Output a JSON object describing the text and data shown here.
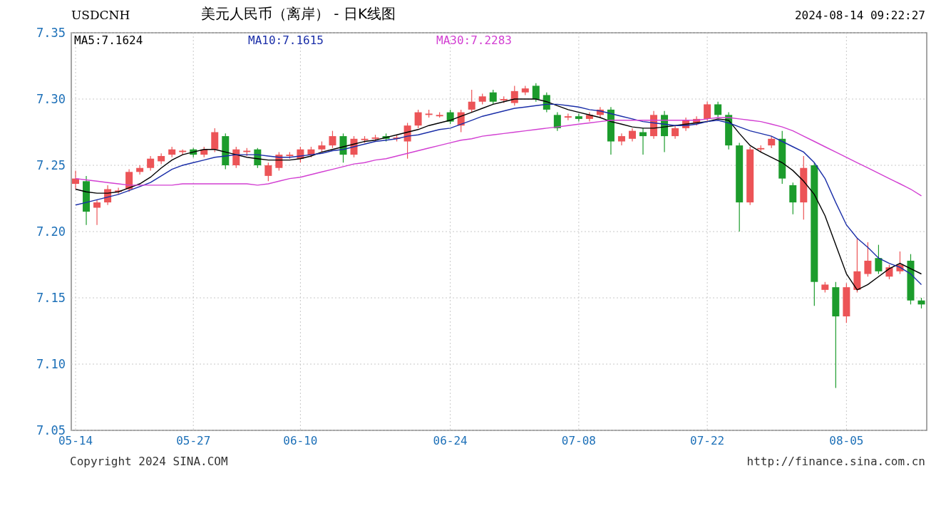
{
  "header": {
    "symbol": "USDCNH",
    "title": "美元人民币（离岸） - 日K线图",
    "timestamp": "2024-08-14 09:22:27"
  },
  "chart_data": {
    "type": "candlestick",
    "grid": true,
    "ylim": [
      7.05,
      7.35
    ],
    "categories": [
      "05-14",
      null,
      null,
      null,
      null,
      null,
      null,
      null,
      null,
      null,
      null,
      "05-27",
      null,
      null,
      null,
      null,
      null,
      null,
      null,
      null,
      null,
      "06-10",
      null,
      null,
      null,
      null,
      null,
      null,
      null,
      null,
      null,
      null,
      null,
      null,
      null,
      "06-24",
      null,
      null,
      null,
      null,
      null,
      null,
      null,
      null,
      null,
      null,
      null,
      "07-08",
      null,
      null,
      null,
      null,
      null,
      null,
      null,
      null,
      null,
      null,
      null,
      "07-22",
      null,
      null,
      null,
      null,
      null,
      null,
      null,
      null,
      null,
      null,
      null,
      null,
      "08-05",
      null,
      null,
      null,
      null,
      null,
      null,
      null
    ],
    "yticks": [
      {
        "value": 7.35,
        "label": "7.35"
      },
      {
        "value": 7.3,
        "label": "7.30"
      },
      {
        "value": 7.25,
        "label": "7.25"
      },
      {
        "value": 7.2,
        "label": "7.20"
      },
      {
        "value": 7.15,
        "label": "7.15"
      },
      {
        "value": 7.1,
        "label": "7.10"
      },
      {
        "value": 7.05,
        "label": "7.05"
      }
    ],
    "ohlc": [
      [
        7.236,
        7.246,
        7.232,
        7.24
      ],
      [
        7.238,
        7.242,
        7.205,
        7.215
      ],
      [
        7.218,
        7.224,
        7.205,
        7.222
      ],
      [
        7.222,
        7.235,
        7.22,
        7.232
      ],
      [
        7.23,
        7.233,
        7.228,
        7.231
      ],
      [
        7.232,
        7.247,
        7.23,
        7.245
      ],
      [
        7.245,
        7.25,
        7.243,
        7.248
      ],
      [
        7.248,
        7.257,
        7.246,
        7.255
      ],
      [
        7.253,
        7.259,
        7.251,
        7.257
      ],
      [
        7.258,
        7.264,
        7.256,
        7.262
      ],
      [
        7.26,
        7.262,
        7.258,
        7.261
      ],
      [
        7.262,
        7.263,
        7.256,
        7.258
      ],
      [
        7.258,
        7.264,
        7.256,
        7.262
      ],
      [
        7.262,
        7.278,
        7.26,
        7.275
      ],
      [
        7.272,
        7.274,
        7.247,
        7.25
      ],
      [
        7.25,
        7.264,
        7.248,
        7.262
      ],
      [
        7.26,
        7.263,
        7.257,
        7.261
      ],
      [
        7.262,
        7.263,
        7.248,
        7.25
      ],
      [
        7.242,
        7.252,
        7.238,
        7.25
      ],
      [
        7.248,
        7.26,
        7.246,
        7.258
      ],
      [
        7.257,
        7.26,
        7.255,
        7.258
      ],
      [
        7.255,
        7.264,
        7.252,
        7.262
      ],
      [
        7.258,
        7.264,
        7.256,
        7.262
      ],
      [
        7.262,
        7.268,
        7.26,
        7.265
      ],
      [
        7.265,
        7.276,
        7.263,
        7.272
      ],
      [
        7.272,
        7.274,
        7.252,
        7.258
      ],
      [
        7.258,
        7.272,
        7.256,
        7.27
      ],
      [
        7.269,
        7.272,
        7.267,
        7.27
      ],
      [
        7.27,
        7.273,
        7.268,
        7.271
      ],
      [
        7.272,
        7.274,
        7.268,
        7.27
      ],
      [
        7.27,
        7.273,
        7.268,
        7.271
      ],
      [
        7.268,
        7.282,
        7.255,
        7.28
      ],
      [
        7.28,
        7.292,
        7.278,
        7.29
      ],
      [
        7.288,
        7.292,
        7.286,
        7.289
      ],
      [
        7.287,
        7.29,
        7.286,
        7.288
      ],
      [
        7.29,
        7.292,
        7.281,
        7.283
      ],
      [
        7.28,
        7.292,
        7.275,
        7.29
      ],
      [
        7.292,
        7.307,
        7.29,
        7.298
      ],
      [
        7.298,
        7.304,
        7.296,
        7.302
      ],
      [
        7.305,
        7.307,
        7.296,
        7.298
      ],
      [
        7.299,
        7.302,
        7.297,
        7.3
      ],
      [
        7.297,
        7.31,
        7.295,
        7.306
      ],
      [
        7.305,
        7.31,
        7.303,
        7.308
      ],
      [
        7.31,
        7.312,
        7.298,
        7.3
      ],
      [
        7.303,
        7.305,
        7.29,
        7.292
      ],
      [
        7.288,
        7.29,
        7.276,
        7.278
      ],
      [
        7.286,
        7.289,
        7.284,
        7.287
      ],
      [
        7.287,
        7.289,
        7.283,
        7.285
      ],
      [
        7.285,
        7.29,
        7.283,
        7.288
      ],
      [
        7.288,
        7.294,
        7.286,
        7.292
      ],
      [
        7.292,
        7.294,
        7.258,
        7.268
      ],
      [
        7.268,
        7.274,
        7.265,
        7.272
      ],
      [
        7.27,
        7.278,
        7.268,
        7.276
      ],
      [
        7.275,
        7.278,
        7.258,
        7.272
      ],
      [
        7.272,
        7.291,
        7.27,
        7.288
      ],
      [
        7.288,
        7.291,
        7.26,
        7.272
      ],
      [
        7.272,
        7.28,
        7.27,
        7.278
      ],
      [
        7.278,
        7.286,
        7.276,
        7.284
      ],
      [
        7.282,
        7.287,
        7.28,
        7.285
      ],
      [
        7.285,
        7.298,
        7.283,
        7.296
      ],
      [
        7.296,
        7.298,
        7.286,
        7.288
      ],
      [
        7.288,
        7.29,
        7.262,
        7.265
      ],
      [
        7.265,
        7.267,
        7.2,
        7.222
      ],
      [
        7.222,
        7.264,
        7.22,
        7.262
      ],
      [
        7.262,
        7.265,
        7.26,
        7.263
      ],
      [
        7.265,
        7.272,
        7.263,
        7.27
      ],
      [
        7.27,
        7.276,
        7.236,
        7.24
      ],
      [
        7.235,
        7.237,
        7.213,
        7.222
      ],
      [
        7.222,
        7.257,
        7.209,
        7.248
      ],
      [
        7.25,
        7.252,
        7.144,
        7.162
      ],
      [
        7.156,
        7.162,
        7.154,
        7.16
      ],
      [
        7.158,
        7.162,
        7.082,
        7.136
      ],
      [
        7.136,
        7.161,
        7.131,
        7.158
      ],
      [
        7.156,
        7.195,
        7.154,
        7.17
      ],
      [
        7.168,
        7.192,
        7.166,
        7.178
      ],
      [
        7.18,
        7.19,
        7.168,
        7.17
      ],
      [
        7.166,
        7.175,
        7.164,
        7.173
      ],
      [
        7.17,
        7.185,
        7.168,
        7.175
      ],
      [
        7.178,
        7.183,
        7.145,
        7.148
      ],
      [
        7.148,
        7.15,
        7.142,
        7.145
      ]
    ],
    "series": [
      {
        "name": "MA5:7.1624",
        "type": "line",
        "color": "#000000",
        "values": [
          7.232,
          7.23,
          7.229,
          7.229,
          7.23,
          7.233,
          7.236,
          7.241,
          7.248,
          7.254,
          7.258,
          7.26,
          7.262,
          7.262,
          7.26,
          7.258,
          7.256,
          7.255,
          7.254,
          7.254,
          7.254,
          7.255,
          7.257,
          7.26,
          7.262,
          7.264,
          7.266,
          7.268,
          7.269,
          7.271,
          7.273,
          7.275,
          7.277,
          7.28,
          7.282,
          7.284,
          7.287,
          7.29,
          7.293,
          7.296,
          7.298,
          7.3,
          7.3,
          7.3,
          7.298,
          7.295,
          7.292,
          7.29,
          7.288,
          7.286,
          7.283,
          7.281,
          7.279,
          7.278,
          7.278,
          7.279,
          7.28,
          7.281,
          7.282,
          7.283,
          7.285,
          7.284,
          7.274,
          7.265,
          7.26,
          7.256,
          7.252,
          7.246,
          7.238,
          7.228,
          7.212,
          7.19,
          7.168,
          7.156,
          7.16,
          7.166,
          7.172,
          7.176,
          7.172,
          7.168
        ]
      },
      {
        "name": "MA10:7.1615",
        "type": "line",
        "color": "#1a2ea8",
        "values": [
          7.22,
          7.222,
          7.224,
          7.226,
          7.228,
          7.231,
          7.234,
          7.237,
          7.242,
          7.247,
          7.25,
          7.252,
          7.254,
          7.256,
          7.257,
          7.258,
          7.258,
          7.258,
          7.257,
          7.256,
          7.256,
          7.257,
          7.258,
          7.259,
          7.261,
          7.262,
          7.264,
          7.266,
          7.268,
          7.269,
          7.27,
          7.272,
          7.273,
          7.275,
          7.277,
          7.278,
          7.281,
          7.284,
          7.287,
          7.289,
          7.291,
          7.293,
          7.294,
          7.295,
          7.296,
          7.296,
          7.295,
          7.294,
          7.292,
          7.291,
          7.289,
          7.287,
          7.285,
          7.283,
          7.282,
          7.281,
          7.28,
          7.28,
          7.281,
          7.283,
          7.284,
          7.282,
          7.279,
          7.276,
          7.274,
          7.272,
          7.268,
          7.264,
          7.26,
          7.252,
          7.24,
          7.222,
          7.205,
          7.195,
          7.188,
          7.18,
          7.176,
          7.173,
          7.168,
          7.16
        ]
      },
      {
        "name": "MA30:7.2283",
        "type": "line",
        "color": "#d23fd2",
        "values": [
          7.24,
          7.239,
          7.238,
          7.237,
          7.236,
          7.235,
          7.235,
          7.235,
          7.235,
          7.235,
          7.236,
          7.236,
          7.236,
          7.236,
          7.236,
          7.236,
          7.236,
          7.235,
          7.236,
          7.238,
          7.24,
          7.241,
          7.243,
          7.245,
          7.247,
          7.249,
          7.251,
          7.252,
          7.254,
          7.255,
          7.257,
          7.259,
          7.261,
          7.263,
          7.265,
          7.267,
          7.269,
          7.27,
          7.272,
          7.273,
          7.274,
          7.275,
          7.276,
          7.277,
          7.278,
          7.279,
          7.28,
          7.281,
          7.282,
          7.283,
          7.284,
          7.284,
          7.284,
          7.284,
          7.284,
          7.284,
          7.284,
          7.284,
          7.284,
          7.285,
          7.286,
          7.286,
          7.285,
          7.284,
          7.283,
          7.281,
          7.279,
          7.276,
          7.272,
          7.268,
          7.264,
          7.26,
          7.256,
          7.252,
          7.248,
          7.244,
          7.24,
          7.236,
          7.232,
          7.227
        ]
      }
    ]
  },
  "footer": {
    "copyright": "Copyright 2024 SINA.COM",
    "url": "http://finance.sina.com.cn"
  }
}
